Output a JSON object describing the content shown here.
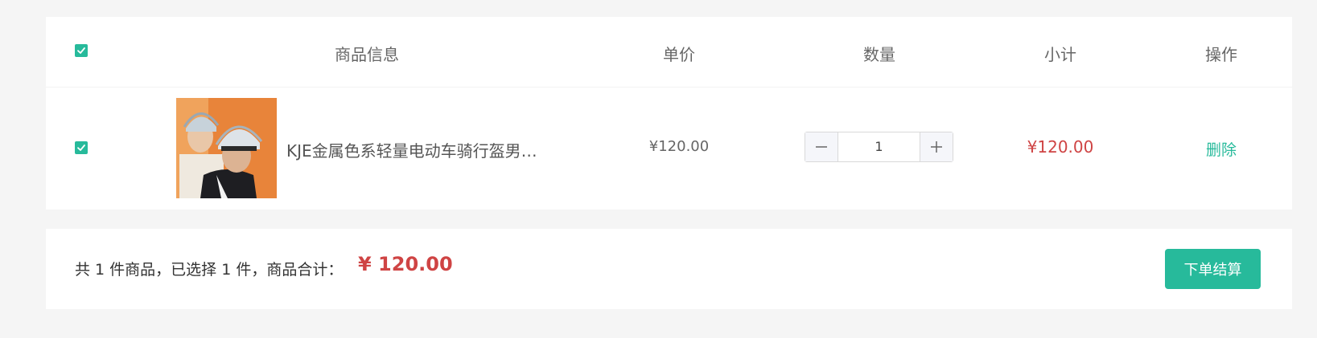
{
  "table": {
    "headers": {
      "product_info": "商品信息",
      "unit_price": "单价",
      "quantity": "数量",
      "subtotal": "小计",
      "actions": "操作"
    },
    "rows": [
      {
        "name": "KJE金属色系轻量电动车骑行盔男女...",
        "unit_price": "¥120.00",
        "quantity": "1",
        "subtotal": "¥120.00",
        "delete_label": "删除"
      }
    ]
  },
  "summary": {
    "text": "共 1 件商品，已选择 1 件，商品合计：",
    "amount": "¥ 120.00",
    "checkout_label": "下单结算"
  },
  "colors": {
    "accent": "#27ba9b",
    "price": "#cf4444"
  },
  "icons": {
    "select_all": "check-icon",
    "row_select": "check-icon",
    "minus": "minus-icon",
    "plus": "plus-icon"
  }
}
